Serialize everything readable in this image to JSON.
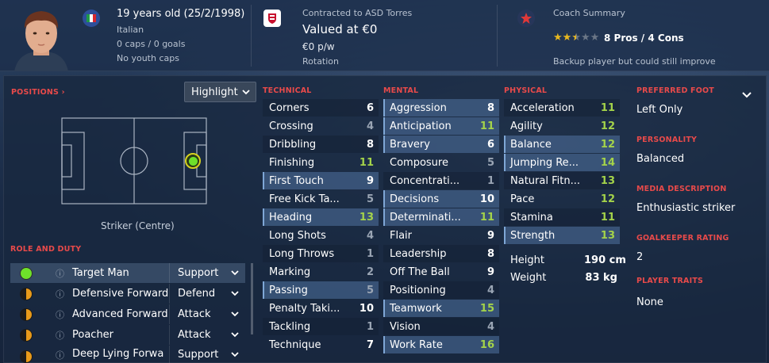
{
  "header": {
    "age": "19 years old (25/2/1998)",
    "nationality": "Italian",
    "caps": "0 caps / 0 goals",
    "youth_caps": "No youth caps",
    "contract": "Contracted to ASD Torres",
    "value": "Valued at €0",
    "wage": "€0 p/w",
    "squad_status": "Rotation",
    "coach_title": "Coach Summary",
    "pros_cons": "8 Pros / 4 Cons",
    "coach_note": "Backup player but could still improve",
    "star_rating": 2.5,
    "star_max": 5
  },
  "positions": {
    "title": "POSITIONS ›",
    "view_select": "Highlight",
    "position_label": "Striker (Centre)"
  },
  "roles": {
    "title": "ROLE AND DUTY",
    "items": [
      {
        "name": "Target Man",
        "duty": "Support",
        "suitability": "natural"
      },
      {
        "name": "Defensive Forward",
        "duty": "Defend",
        "suitability": "half"
      },
      {
        "name": "Advanced Forward",
        "duty": "Attack",
        "suitability": "half"
      },
      {
        "name": "Poacher",
        "duty": "Attack",
        "suitability": "half"
      },
      {
        "name": "Deep Lying Forwa",
        "duty": "Support",
        "suitability": "half"
      }
    ]
  },
  "technical": {
    "title": "TECHNICAL",
    "items": [
      {
        "name": "Corners",
        "value": "6"
      },
      {
        "name": "Crossing",
        "value": "4"
      },
      {
        "name": "Dribbling",
        "value": "8"
      },
      {
        "name": "Finishing",
        "value": "11"
      },
      {
        "name": "First Touch",
        "value": "9"
      },
      {
        "name": "Free Kick Ta...",
        "value": "5"
      },
      {
        "name": "Heading",
        "value": "13"
      },
      {
        "name": "Long Shots",
        "value": "4"
      },
      {
        "name": "Long Throws",
        "value": "1"
      },
      {
        "name": "Marking",
        "value": "2"
      },
      {
        "name": "Passing",
        "value": "5"
      },
      {
        "name": "Penalty Taki...",
        "value": "10"
      },
      {
        "name": "Tackling",
        "value": "1"
      },
      {
        "name": "Technique",
        "value": "7"
      }
    ]
  },
  "mental": {
    "title": "MENTAL",
    "items": [
      {
        "name": "Aggression",
        "value": "8"
      },
      {
        "name": "Anticipation",
        "value": "11"
      },
      {
        "name": "Bravery",
        "value": "6"
      },
      {
        "name": "Composure",
        "value": "5"
      },
      {
        "name": "Concentrati...",
        "value": "1"
      },
      {
        "name": "Decisions",
        "value": "10"
      },
      {
        "name": "Determinati...",
        "value": "11"
      },
      {
        "name": "Flair",
        "value": "9"
      },
      {
        "name": "Leadership",
        "value": "8"
      },
      {
        "name": "Off The Ball",
        "value": "9"
      },
      {
        "name": "Positioning",
        "value": "4"
      },
      {
        "name": "Teamwork",
        "value": "15"
      },
      {
        "name": "Vision",
        "value": "4"
      },
      {
        "name": "Work Rate",
        "value": "16"
      }
    ]
  },
  "physical": {
    "title": "PHYSICAL",
    "items": [
      {
        "name": "Acceleration",
        "value": "11"
      },
      {
        "name": "Agility",
        "value": "12"
      },
      {
        "name": "Balance",
        "value": "12"
      },
      {
        "name": "Jumping Re...",
        "value": "14"
      },
      {
        "name": "Natural Fitn...",
        "value": "13"
      },
      {
        "name": "Pace",
        "value": "12"
      },
      {
        "name": "Stamina",
        "value": "11"
      },
      {
        "name": "Strength",
        "value": "13"
      }
    ],
    "height_label": "Height",
    "height_value": "190 cm",
    "weight_label": "Weight",
    "weight_value": "83 kg"
  },
  "info": {
    "preferred_foot_title": "PREFERRED FOOT",
    "preferred_foot": "Left Only",
    "personality_title": "PERSONALITY",
    "personality": "Balanced",
    "media_title": "MEDIA DESCRIPTION",
    "media": "Enthusiastic striker",
    "gk_title": "GOALKEEPER RATING",
    "gk_rating": "2",
    "traits_title": "PLAYER TRAITS",
    "traits": "None"
  },
  "colors": {
    "section_title": "#e84a4a",
    "high_value": "#a4d34a",
    "low_value": "#9aa5b4",
    "natural_role": "#6ee02a",
    "half_role": "#e89a1a"
  },
  "icons": [
    "italy-flag-icon",
    "club-crest-icon",
    "star-badge-icon",
    "info-icon",
    "chevron-down-icon"
  ]
}
